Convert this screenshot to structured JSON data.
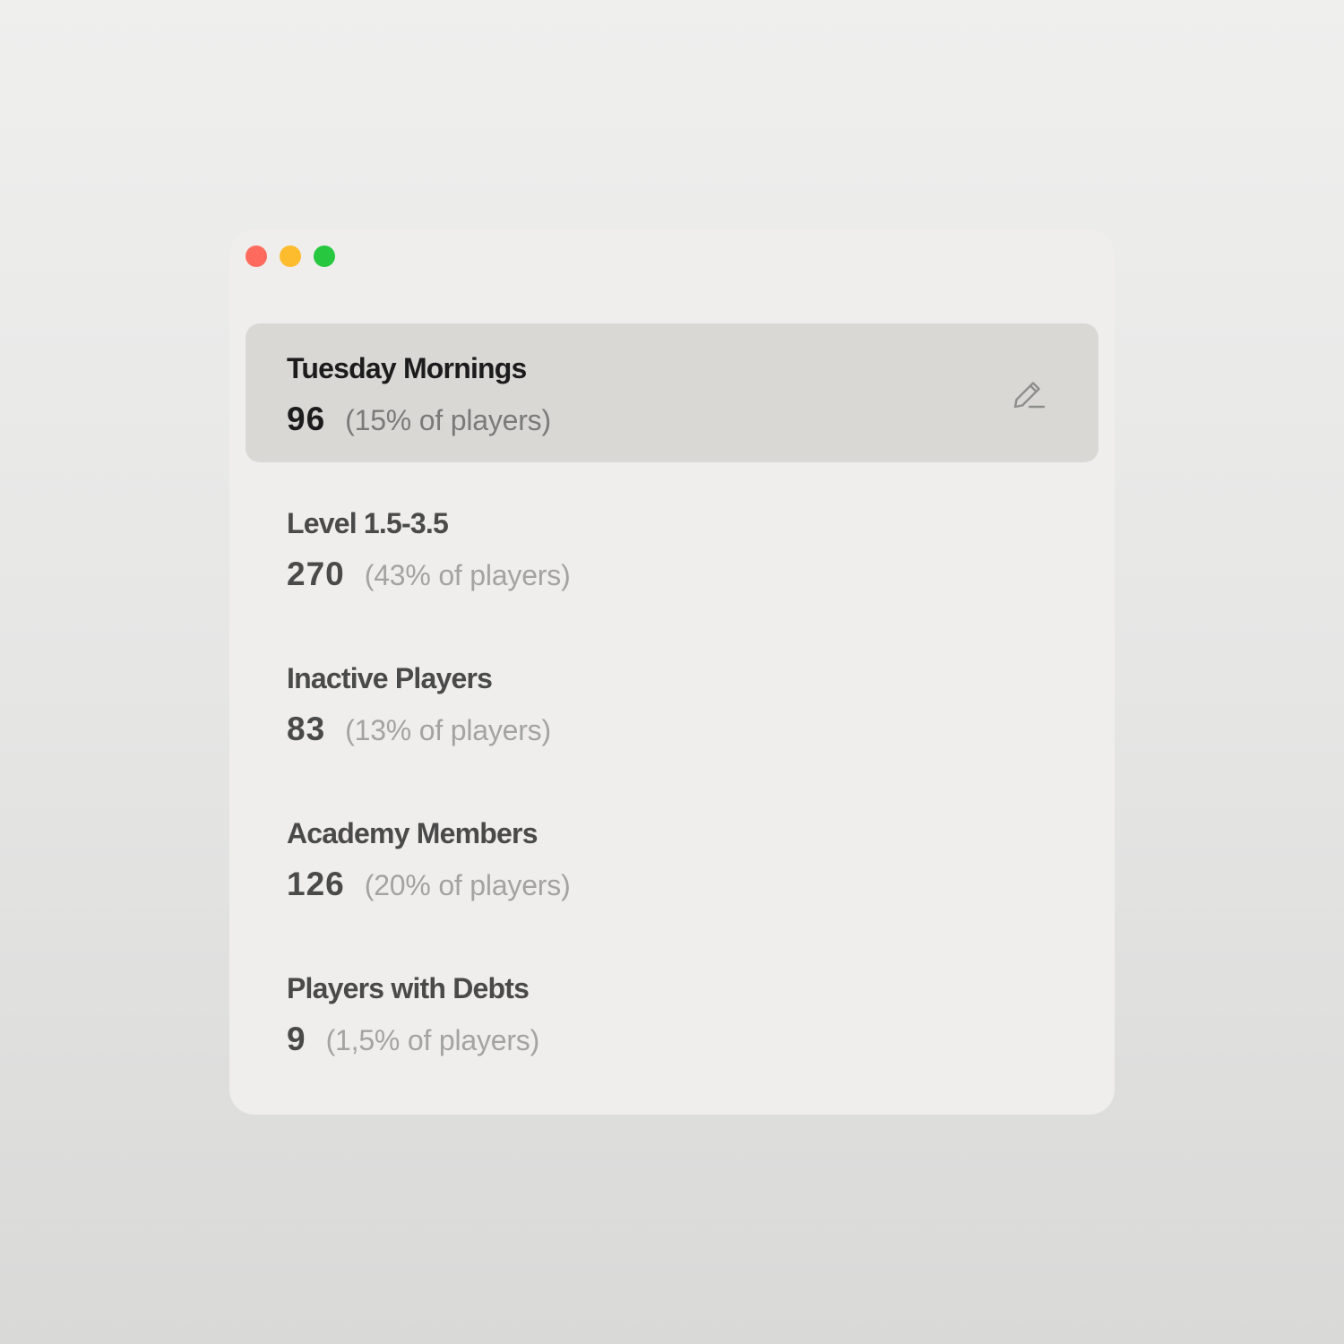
{
  "window": {
    "controls": [
      {
        "name": "close",
        "color": "#ff6a5f"
      },
      {
        "name": "minimize",
        "color": "#fdbb2e"
      },
      {
        "name": "zoom",
        "color": "#27c840"
      }
    ]
  },
  "segments": [
    {
      "name": "Tuesday Mornings",
      "count": "96",
      "percent": "(15% of players)",
      "selected": true,
      "edit_icon": "pencil-icon"
    },
    {
      "name": "Level 1.5-3.5",
      "count": "270",
      "percent": "(43% of players)",
      "selected": false
    },
    {
      "name": "Inactive Players",
      "count": "83",
      "percent": "(13% of players)",
      "selected": false
    },
    {
      "name": "Academy Members",
      "count": "126",
      "percent": "(20% of players)",
      "selected": false
    },
    {
      "name": "Players with Debts",
      "count": "9",
      "percent": "(1,5% of players)",
      "selected": false
    }
  ]
}
